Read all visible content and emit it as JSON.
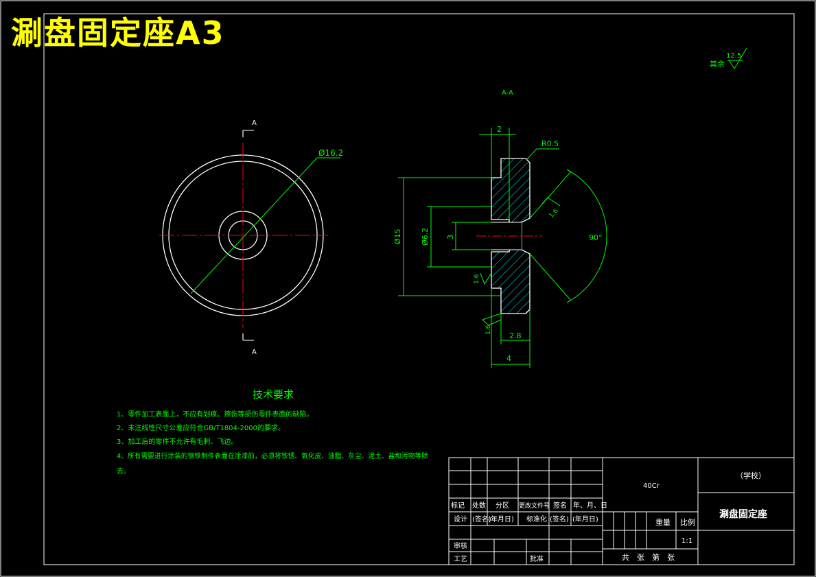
{
  "drawing_title": "涮盘固定座A3",
  "section_label": "A-A",
  "section_mark_top": "A",
  "section_mark_bottom": "A",
  "roughness_general": {
    "prefix": "其余",
    "value": "12.5"
  },
  "dimensions": {
    "outer_diameter": "Ø16.2",
    "radius": "R0.5",
    "top_width": "2",
    "dia15": "Ø15",
    "dia6": "Ø6.2",
    "hole3": "3",
    "angle": "90°",
    "rough_face": "1.6",
    "rough_left": "1.6",
    "rough_bottom": "1.6",
    "bottom_small": "2.8",
    "total_width": "4"
  },
  "tech_requirements": {
    "title": "技术要求",
    "items": [
      "1、零件加工表面上，不应有划痕、擦伤等损伤零件表面的缺陷。",
      "2、未注线性尺寸公差应符合GB/T1804-2000的要求。",
      "3、加工后的零件不允许有毛刺、飞边。",
      "4、所有需要进行涂装的钢铁制件表面在涂漆前，必须将铁锈、氧化皮、油脂、灰尘、泥土、盐和污物等除",
      "去。"
    ]
  },
  "title_block": {
    "material": "40Cr",
    "school": "（学校）",
    "part_name": "涮盘固定座",
    "weight_label": "重量",
    "scale_label": "比例",
    "scale_value": "1:1",
    "sheets": "共　张　第　张",
    "row_mark": [
      "标记",
      "处数",
      "分区",
      "更改文件号",
      "签名",
      "年、月、日"
    ],
    "row_design": [
      "设计",
      "(签名)",
      "(年月日)",
      "标准化",
      "(签名)",
      "(年月日)"
    ],
    "review": "审核",
    "process": "工艺",
    "approve": "批准"
  }
}
